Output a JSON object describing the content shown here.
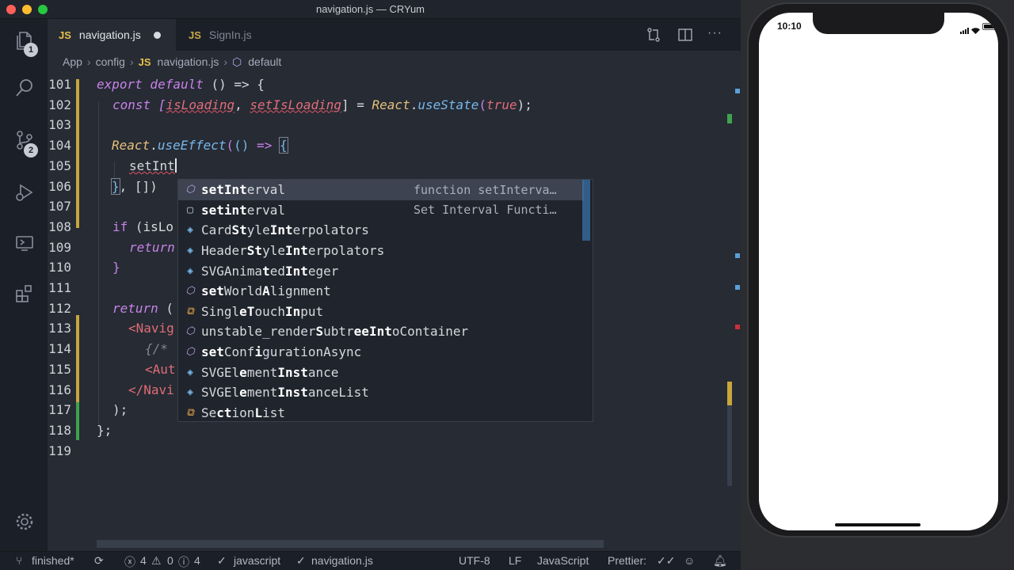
{
  "window": {
    "title": "navigation.js — CRYum"
  },
  "activity_bar": {
    "explorer_badge": "1",
    "source_control_badge": "2"
  },
  "tabs": [
    {
      "icon": "JS",
      "label": "navigation.js",
      "modified": true,
      "active": true
    },
    {
      "icon": "JS",
      "label": "SignIn.js",
      "modified": false,
      "active": false
    }
  ],
  "breadcrumb": {
    "items": [
      "App",
      "config",
      "navigation.js",
      "default"
    ],
    "file_icon": "JS"
  },
  "editor": {
    "line_numbers": [
      "101",
      "102",
      "103",
      "104",
      "105",
      "106",
      "107",
      "108",
      "109",
      "110",
      "111",
      "112",
      "113",
      "114",
      "115",
      "116",
      "117",
      "118",
      "119"
    ],
    "lines": {
      "l101": {
        "a": "export default",
        "b": " () => {"
      },
      "l102": {
        "a": "const [",
        "b": "isLoading",
        "c": ", ",
        "d": "setIsLoading",
        "e": "] = ",
        "f": "React",
        "g": ".",
        "h": "useState",
        "i": "(",
        "j": "true",
        "k": ");"
      },
      "l104": {
        "a": "React",
        "b": ".",
        "c": "useEffect",
        "d": "(",
        "e": "()",
        "f": " => ",
        "g": "{"
      },
      "l105": {
        "a": "setInt"
      },
      "l106": {
        "a": "}",
        "b": ", [])"
      },
      "l108": {
        "a": "if",
        "b": " (isLo"
      },
      "l109": {
        "a": "return"
      },
      "l110": {
        "a": "}"
      },
      "l112": {
        "a": "return",
        "b": " ("
      },
      "l113": {
        "a": "<Navig"
      },
      "l114": {
        "a": "{/*"
      },
      "l115": {
        "a": "<Aut"
      },
      "l116": {
        "a": "</Navi"
      },
      "l117": {
        "a": ");"
      },
      "l118": {
        "a": "};"
      }
    }
  },
  "autocomplete": {
    "items": [
      {
        "kind": "function",
        "pre": "",
        "hl": "setInt",
        "post": "erval",
        "detail": "function setInterva…",
        "selected": true
      },
      {
        "kind": "snippet",
        "pre": "",
        "hl": "setint",
        "post": "erval",
        "detail": "Set Interval Functi…",
        "selected": false
      },
      {
        "kind": "variable",
        "pre": "Card",
        "hl": "St",
        "mid": "yle",
        "hl2": "Int",
        "post": "erpolators",
        "detail": "",
        "selected": false
      },
      {
        "kind": "variable",
        "pre": "Header",
        "hl": "St",
        "mid": "yle",
        "hl2": "Int",
        "post": "erpolators",
        "detail": "",
        "selected": false
      },
      {
        "kind": "variable",
        "pre": "SVGAnima",
        "hl": "t",
        "mid": "ed",
        "hl2": "Int",
        "post": "eger",
        "detail": "",
        "selected": false
      },
      {
        "kind": "function",
        "pre": "",
        "hl": "set",
        "mid": "World",
        "hl2": "A",
        "post": "lignment",
        "detail": "",
        "selected": false
      },
      {
        "kind": "class",
        "pre": "Singl",
        "hl": "eT",
        "mid": "ouch",
        "hl2": "In",
        "post": "put",
        "detail": "",
        "selected": false
      },
      {
        "kind": "function",
        "pre": "unstable_render",
        "hl": "S",
        "mid": "ubtr",
        "hl2": "eeInt",
        "post": "oContainer",
        "detail": "",
        "selected": false
      },
      {
        "kind": "function",
        "pre": "",
        "hl": "set",
        "mid": "Conf",
        "hl2": "i",
        "post": "gurationAsync",
        "detail": "",
        "selected": false
      },
      {
        "kind": "variable",
        "pre": "SVGEl",
        "hl": "e",
        "mid": "ment",
        "hl2": "Inst",
        "post": "ance",
        "detail": "",
        "selected": false
      },
      {
        "kind": "variable",
        "pre": "SVGEl",
        "hl": "e",
        "mid": "ment",
        "hl2": "Inst",
        "post": "anceList",
        "detail": "",
        "selected": false
      },
      {
        "kind": "class",
        "pre": "Se",
        "hl": "ct",
        "mid": "ion",
        "hl2": "L",
        "post": "ist",
        "detail": "",
        "selected": false
      }
    ]
  },
  "status_bar": {
    "branch": "finished*",
    "errors": "4",
    "warnings": "0",
    "info": "4",
    "language_service": "javascript",
    "file": "navigation.js",
    "encoding": "UTF-8",
    "eol": "LF",
    "language": "JavaScript",
    "formatter": "Prettier:"
  },
  "simulator": {
    "time": "10:10"
  },
  "colors": {
    "editor_bg": "#262b34",
    "selection": "#3d4350",
    "keyword": "#c882e8",
    "function": "#78b8ec",
    "class": "#e5c07b",
    "constant": "#e26d7a",
    "js_icon": "#e8c04c"
  }
}
